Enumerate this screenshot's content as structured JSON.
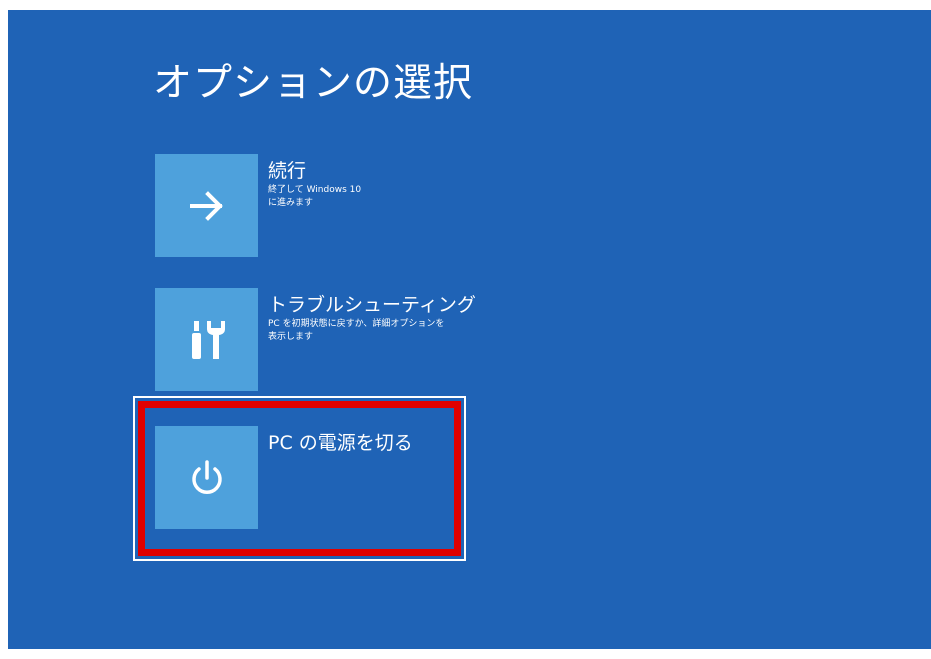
{
  "screen": {
    "title": "オプションの選択"
  },
  "options": [
    {
      "title": "続行",
      "description": "終了して Windows 10\nに進みます",
      "icon": "arrow-right-icon"
    },
    {
      "title": "トラブルシューティング",
      "description": "PC を初期状態に戻すか、詳細オプションを\n表示します",
      "icon": "tools-icon"
    },
    {
      "title": "PC の電源を切る",
      "description": "",
      "icon": "power-icon"
    }
  ],
  "colors": {
    "background": "#1f63b6",
    "tile": "#4ea1dc",
    "highlight": "#e00000"
  }
}
